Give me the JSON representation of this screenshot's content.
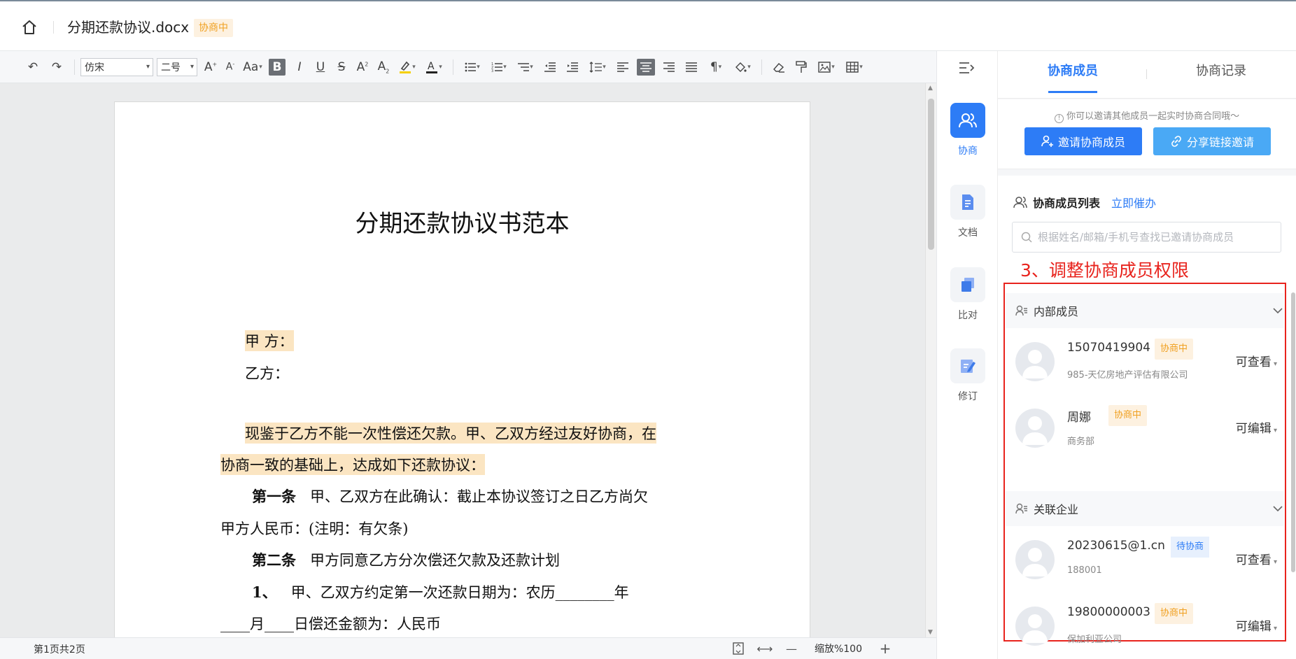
{
  "app": {
    "doc_title": "分期还款协议.docx",
    "doc_status": "协商中"
  },
  "toolbar": {
    "undo_icon": "undo-icon",
    "redo_icon": "redo-icon",
    "font_family": "仿宋",
    "font_size": "二号"
  },
  "document": {
    "title": "分期还款协议书范本",
    "party_a": "甲 方：",
    "party_b": "乙方：",
    "para1_line1": "现鉴于乙方不能一次性偿还欠款。甲、乙双方经过友好协商，在",
    "para1_line2": "协商一致的基础上，达成如下还款协议：",
    "art1_label": "第一条",
    "art1_text": "甲、乙双方在此确认：截止本协议签订之日乙方尚欠",
    "art1_line2": "甲方人民币：(注明：有欠条)",
    "art2_label": "第二条",
    "art2_text": "甲方同意乙方分次偿还欠款及还款计划",
    "item1_label": "1、",
    "item1_text": "甲、乙双方约定第一次还款日期为：农历________年",
    "item1_line2": "____月____日偿还金额为：人民币"
  },
  "status": {
    "page_info": "第1页共2页",
    "zoom": "缩放%100"
  },
  "sidenav": [
    {
      "label": "协商",
      "icon": "users-icon",
      "active": true
    },
    {
      "label": "文档",
      "icon": "document-icon",
      "active": false
    },
    {
      "label": "比对",
      "icon": "compare-icon",
      "active": false
    },
    {
      "label": "修订",
      "icon": "revise-icon",
      "active": false
    }
  ],
  "panel": {
    "tab_members": "协商成员",
    "tab_records": "协商记录",
    "invite_hint": "你可以邀请其他成员一起实时协商合同哦～",
    "invite_button": "邀请协商成员",
    "share_button": "分享链接邀请",
    "list_title": "协商成员列表",
    "urge_link": "立即催办",
    "search_placeholder": "根据姓名/邮箱/手机号查找已邀请协商成员",
    "annotation": "3、调整协商成员权限",
    "groups": [
      {
        "name": "内部成员",
        "members": [
          {
            "name": "15070419904",
            "badge": "协商中",
            "org": "985-天亿房地产评估有限公司",
            "permission": "可查看"
          },
          {
            "name": "周娜",
            "badge": "协商中",
            "org": "商务部",
            "permission": "可编辑"
          }
        ]
      },
      {
        "name": "关联企业",
        "members": [
          {
            "name": "20230615@1.cn",
            "badge": "待协商",
            "org": "188001",
            "permission": "可查看"
          },
          {
            "name": "19800000003",
            "badge": "协商中",
            "org": "保加利亚公司",
            "permission": "可编辑"
          }
        ]
      }
    ]
  },
  "colors": {
    "accent": "#2d7cf6",
    "share_button": "#4aa9f5",
    "badge_orange_bg": "#fdf1e0",
    "badge_orange_text": "#f0a020",
    "annotation_red": "#e8231d",
    "highlight": "#fbe5c2"
  }
}
